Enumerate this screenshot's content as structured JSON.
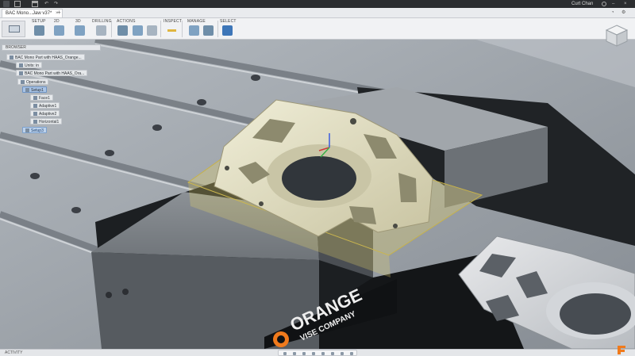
{
  "titlebar": {
    "right_user": "Curt Chan"
  },
  "tabs": [
    {
      "label": "BAC Mono...Jaw v37*"
    }
  ],
  "toolbar": {
    "groups": [
      "SETUP",
      "2D",
      "3D",
      "DRILLING",
      "ACTIONS",
      "INSPECT",
      "MANAGE",
      "SELECT"
    ]
  },
  "browser": {
    "header": "BROWSER",
    "nodes": [
      {
        "label": "BAC Mono Part with HAAS_Orange..."
      },
      {
        "label": "Units: in"
      },
      {
        "label": "BAC Mono Part with HAAS_Ora..."
      },
      {
        "label": "Operations"
      },
      {
        "label": "Setup1"
      },
      {
        "label": "Face1"
      },
      {
        "label": "Adaptive1"
      },
      {
        "label": "Adaptive2"
      },
      {
        "label": "Horizontal1"
      },
      {
        "label": "Setup3"
      }
    ]
  },
  "viewport": {
    "vise_brand_line1": "ORANGE",
    "vise_brand_line2": "VISE COMPANY"
  },
  "bottom": {
    "activity_label": "ACTIVITY"
  },
  "colors": {
    "accent_blue": "#3d76b8",
    "stock_highlight": "#e6d36a",
    "vise_orange": "#f07a1c"
  }
}
